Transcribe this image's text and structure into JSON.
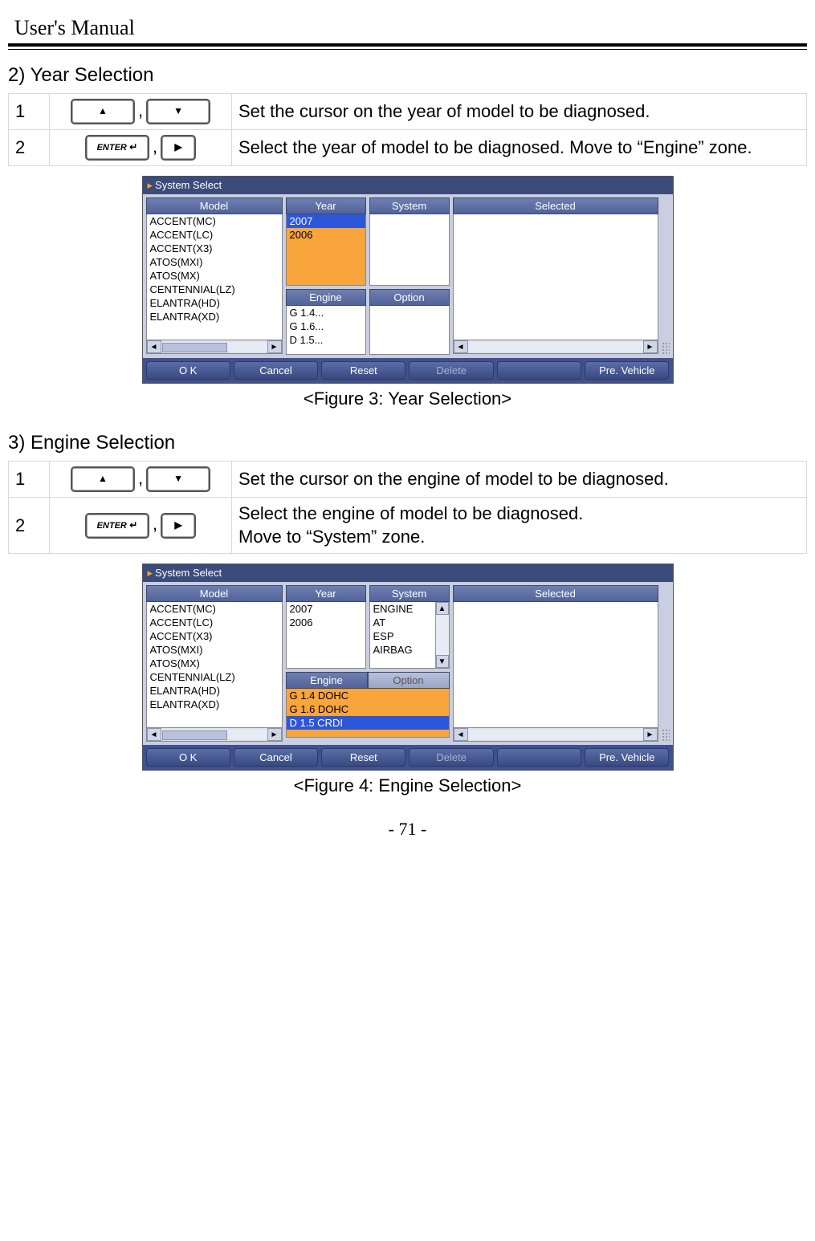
{
  "header": {
    "title": "User's Manual"
  },
  "page_number": "- 71 -",
  "section2": {
    "title": "2) Year Selection",
    "rows": [
      {
        "num": "1",
        "keys": "up_down",
        "desc": "Set the cursor on the year of model to be diagnosed."
      },
      {
        "num": "2",
        "keys": "enter_right",
        "desc": "Select the year of model to be diagnosed. Move to “Engine” zone."
      }
    ],
    "caption": "<Figure 3: Year Selection>"
  },
  "section3": {
    "title": "3) Engine Selection",
    "rows": [
      {
        "num": "1",
        "keys": "up_down",
        "desc": "Set the cursor on the engine of model to be diagnosed."
      },
      {
        "num": "2",
        "keys": "enter_right",
        "desc": "Select the engine of model to be diagnosed.\nMove to “System” zone."
      }
    ],
    "caption": "<Figure 4: Engine Selection>"
  },
  "key_labels": {
    "enter": "ENTER"
  },
  "mock_common": {
    "title": "System Select",
    "headers": {
      "model": "Model",
      "year": "Year",
      "system": "System",
      "selected": "Selected",
      "engine": "Engine",
      "option": "Option"
    },
    "buttons": {
      "ok": "O K",
      "cancel": "Cancel",
      "reset": "Reset",
      "delete": "Delete",
      "empty": "",
      "pre": "Pre. Vehicle"
    }
  },
  "fig3": {
    "model_list": [
      "ACCENT(MC)",
      "ACCENT(LC)",
      "ACCENT(X3)",
      "ATOS(MXI)",
      "ATOS(MX)",
      "CENTENNIAL(LZ)",
      "ELANTRA(HD)",
      "ELANTRA(XD)"
    ],
    "year_list": [
      "2007",
      "2006"
    ],
    "year_selected_index": 0,
    "engine_list": [
      "G 1.4...",
      "G 1.6...",
      "D 1.5..."
    ],
    "system_list": [],
    "option_list": [],
    "selected_list": []
  },
  "fig4": {
    "model_list": [
      "ACCENT(MC)",
      "ACCENT(LC)",
      "ACCENT(X3)",
      "ATOS(MXI)",
      "ATOS(MX)",
      "CENTENNIAL(LZ)",
      "ELANTRA(HD)",
      "ELANTRA(XD)"
    ],
    "year_list": [
      "2007",
      "2006"
    ],
    "engine_list": [
      "G 1.4 DOHC",
      "G 1.6 DOHC",
      "D 1.5 CRDI"
    ],
    "engine_selected_index": 2,
    "system_list": [
      "ENGINE",
      "AT",
      "ESP",
      "AIRBAG"
    ],
    "option_list": [],
    "selected_list": []
  }
}
